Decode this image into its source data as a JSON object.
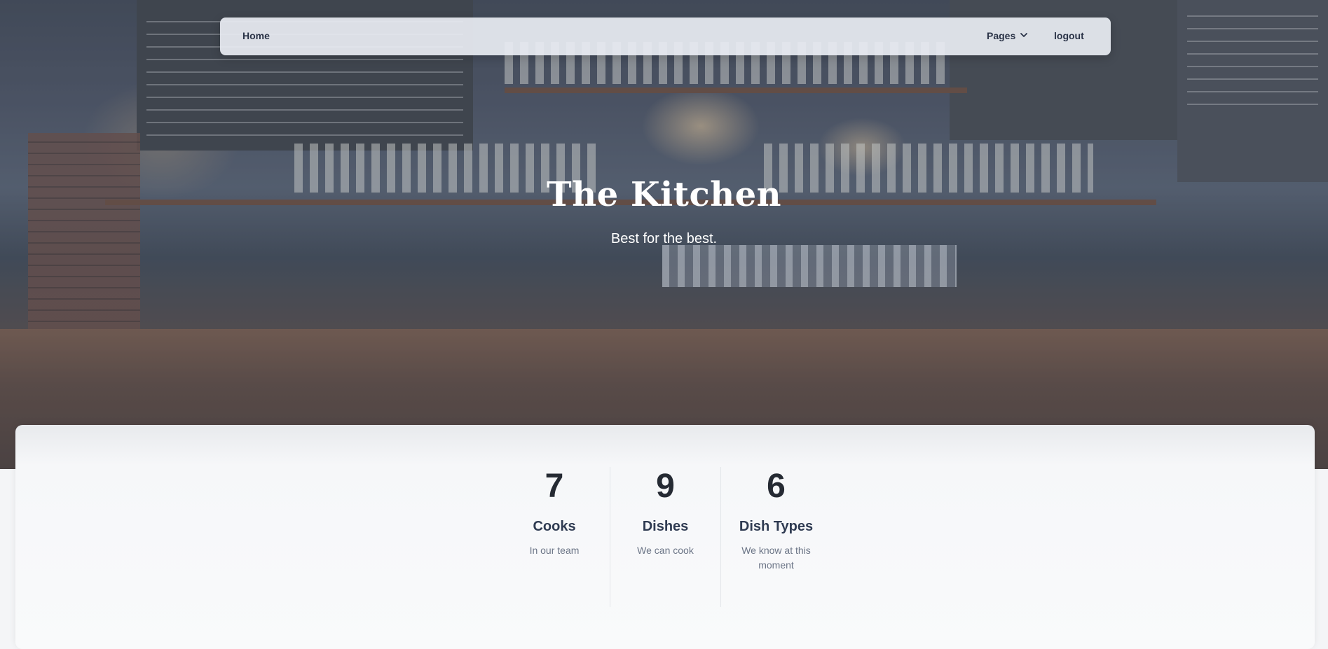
{
  "navbar": {
    "home_label": "Home",
    "pages_label": "Pages",
    "logout_label": "logout"
  },
  "hero": {
    "title": "The Kitchen",
    "subtitle": "Best for the best."
  },
  "stats": [
    {
      "value": "7",
      "label": "Cooks",
      "description": "In our team"
    },
    {
      "value": "9",
      "label": "Dishes",
      "description": "We can cook"
    },
    {
      "value": "6",
      "label": "Dish Types",
      "description": "We know at this moment"
    }
  ],
  "colors": {
    "nav_text": "#2a3347",
    "stat_value": "#252a33",
    "stat_label": "#2f3b52",
    "stat_desc": "#6b7486"
  },
  "icons": {
    "pages_dropdown": "chevron-down-icon"
  }
}
